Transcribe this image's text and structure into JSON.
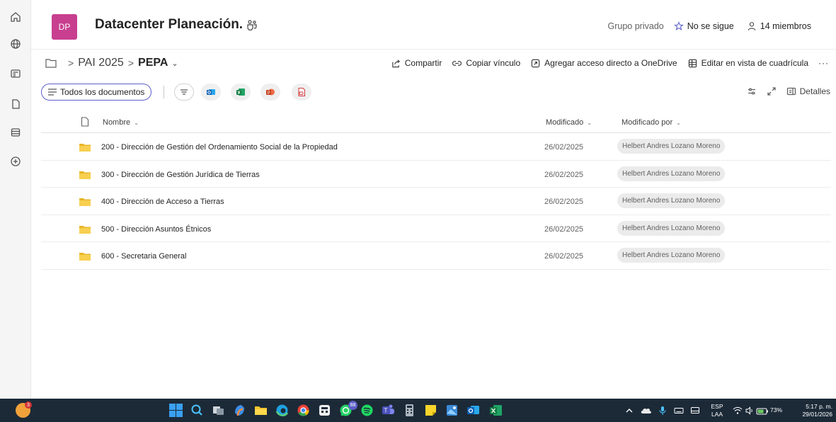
{
  "site": {
    "logo_initials": "DP",
    "title": "Datacenter Planeación.",
    "privacy": "Grupo privado",
    "follow_label": "No se sigue",
    "members_label": "14 miembros",
    "logo_color": "#c83f8f"
  },
  "breadcrumb": {
    "items": [
      "PAI 2025",
      "PEPA"
    ],
    "separator": ">"
  },
  "commands": {
    "share": "Compartir",
    "copy_link": "Copiar vínculo",
    "shortcut": "Agregar acceso directo a OneDrive",
    "grid_edit": "Editar en vista de cuadrícula",
    "more": "···"
  },
  "view": {
    "current_view": "Todos los documentos",
    "details_label": "Detalles",
    "accent_color": "#5b5fc7"
  },
  "table": {
    "columns": {
      "name": "Nombre",
      "modified": "Modificado",
      "modified_by": "Modificado por"
    },
    "rows": [
      {
        "name": "200 - Dirección de Gestión del Ordenamiento Social de la Propiedad",
        "modified": "26/02/2025",
        "modified_by": "Helbert Andres Lozano Moreno"
      },
      {
        "name": "300 - Dirección de Gestión Jurídica de Tierras",
        "modified": "26/02/2025",
        "modified_by": "Helbert Andres Lozano Moreno"
      },
      {
        "name": "400 - Dirección de Acceso a Tierras",
        "modified": "26/02/2025",
        "modified_by": "Helbert Andres Lozano Moreno"
      },
      {
        "name": "500 - Dirección Asuntos Étnicos",
        "modified": "26/02/2025",
        "modified_by": "Helbert Andres Lozano Moreno"
      },
      {
        "name": "600 - Secretaria General",
        "modified": "26/02/2025",
        "modified_by": "Helbert Andres Lozano Moreno"
      }
    ],
    "folder_color": "#f4c430"
  },
  "taskbar": {
    "weather_badge": "3",
    "whatsapp_badge": "88",
    "language_top": "ESP",
    "language_bottom": "LAA",
    "battery": "73%",
    "time": "5:17 p. m.",
    "date": "29/01/2026",
    "background_color": "#1c2a38"
  }
}
